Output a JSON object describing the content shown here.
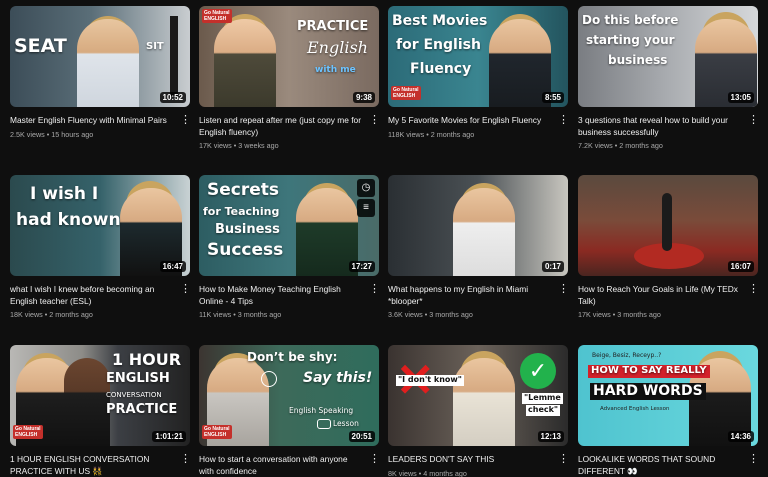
{
  "videos": [
    {
      "title": "Master English Fluency with Minimal Pairs",
      "stats": "2.5K views • 15 hours ago",
      "duration": "10:52",
      "overlay": [
        "SEAT",
        "SIT"
      ]
    },
    {
      "title": "Listen and repeat after me (just copy me for English fluency)",
      "stats": "17K views • 3 weeks ago",
      "duration": "9:38",
      "overlay": [
        "PRACTICE",
        "English",
        "with me"
      ]
    },
    {
      "title": "My 5 Favorite Movies for English Fluency",
      "stats": "118K views • 2 months ago",
      "duration": "8:55",
      "overlay": [
        "Best Movies",
        "for English",
        "Fluency"
      ]
    },
    {
      "title": "3 questions that reveal how to build your business successfully",
      "stats": "7.2K views • 2 months ago",
      "duration": "13:05",
      "overlay": [
        "Do this before",
        "starting your",
        "business"
      ]
    },
    {
      "title": "what I wish I knew before becoming an English teacher (ESL)",
      "stats": "18K views • 2 months ago",
      "duration": "16:47",
      "overlay": [
        "I wish I",
        "had known"
      ]
    },
    {
      "title": "How to Make Money Teaching English Online - 4 Tips",
      "stats": "11K views • 3 months ago",
      "duration": "17:27",
      "overlay": [
        "Secrets",
        "for Teaching",
        "Business",
        "Success"
      ]
    },
    {
      "title": "What happens to my English in Miami *blooper*",
      "stats": "3.6K views • 3 months ago",
      "duration": "0:17",
      "overlay": []
    },
    {
      "title": "How to Reach Your Goals in Life (My TEDx Talk)",
      "stats": "17K views • 3 months ago",
      "duration": "16:07",
      "overlay": []
    },
    {
      "title": "1 HOUR ENGLISH CONVERSATION PRACTICE WITH US 👯",
      "stats": "",
      "duration": "1:01:21",
      "overlay": [
        "1 HOUR",
        "ENGLISH",
        "CONVERSATION",
        "PRACTICE"
      ]
    },
    {
      "title": "How to start a conversation with anyone with confidence",
      "stats": "",
      "duration": "20:51",
      "overlay": [
        "Don’t be shy:",
        "Say this!",
        "English Speaking",
        "Lesson"
      ]
    },
    {
      "title": "LEADERS DON'T SAY THIS",
      "stats": "8K views • 4 months ago",
      "duration": "12:13",
      "overlay": [
        "\"I don't know\"",
        "\"Lemme",
        "check\""
      ]
    },
    {
      "title": "LOOKALIKE WORDS THAT SOUND DIFFERENT 👀",
      "stats": "",
      "duration": "14:36",
      "overlay": [
        "Beige, Besiz, Receyp..?",
        "HOW TO SAY REALLY",
        "HARD WORDS",
        "Advanced English Lesson"
      ]
    }
  ],
  "badge": {
    "brand": "Go Natural",
    "sub": "ENGLISH"
  },
  "colors": {
    "background": "#0f0f0f",
    "text": "#f1f1f1",
    "meta": "#aaaaaa",
    "brand_red": "#c4302b"
  },
  "icons": {
    "more": "vertical-ellipsis",
    "watch_later": "clock-icon",
    "add_to_queue": "queue-icon"
  }
}
